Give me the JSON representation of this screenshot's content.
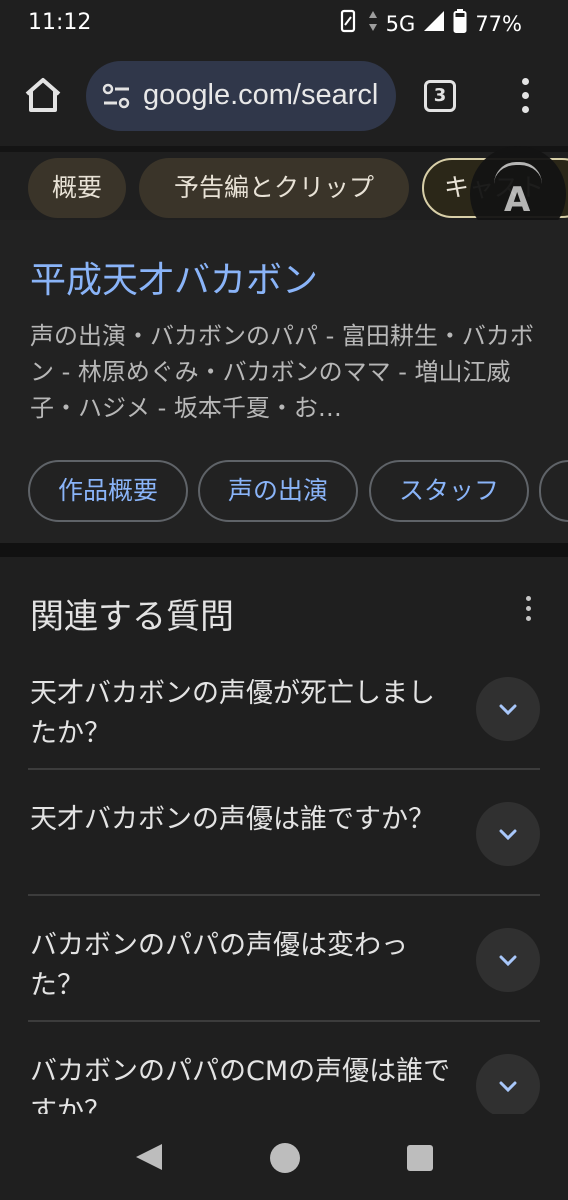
{
  "status_bar": {
    "time": "11:12",
    "network": "5G",
    "battery": "77%",
    "icons": [
      "vibrate-icon",
      "data-arrows-icon",
      "signal-icon",
      "battery-icon"
    ]
  },
  "browser": {
    "url": "google.com/searcl",
    "tab_count": "3",
    "icons": [
      "home-icon",
      "tune-icon",
      "tabs-icon",
      "more-vert-icon"
    ]
  },
  "chips": [
    {
      "label": "概要"
    },
    {
      "label": "予告編とクリップ"
    },
    {
      "label": "キャスト"
    }
  ],
  "knowledge_panel": {
    "title": "平成天才バカボン",
    "description": "声の出演・バカボンのパパ - 富田耕生・バカボン - 林原めぐみ・バカボンのママ - 増山江威子・ハジメ - 坂本千夏・お…",
    "links": [
      {
        "label": "作品概要"
      },
      {
        "label": "声の出演"
      },
      {
        "label": "スタッフ"
      }
    ]
  },
  "related_questions": {
    "title": "関連する質問",
    "items": [
      {
        "question": "天才バカボンの声優が死亡しましたか？"
      },
      {
        "question": "天才バカボンの声優は誰ですか？"
      },
      {
        "question": "バカボンのパパの声優は変わった？"
      },
      {
        "question": "バカボンのパパのCMの声優は誰ですか？"
      }
    ]
  },
  "floating_button": {
    "letter": "A"
  },
  "colors": {
    "background": "#1f1f1f",
    "link": "#8ab4f8",
    "chip_bg": "#3a3429",
    "url_bar": "#30374a"
  }
}
